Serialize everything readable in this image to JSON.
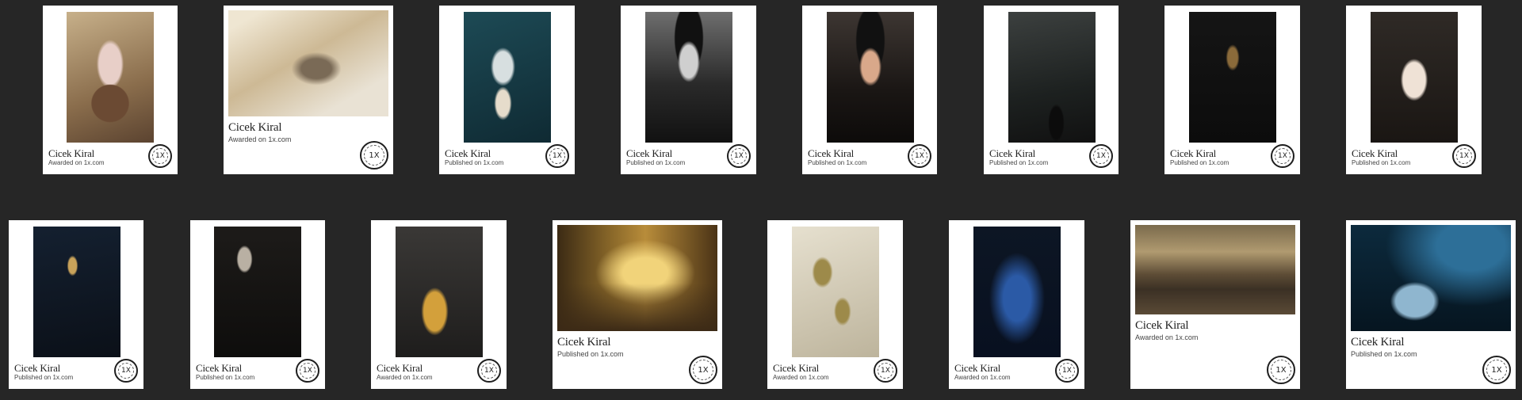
{
  "badge_label": "1X",
  "gallery": {
    "cards": [
      {
        "photographer": "Cicek Kiral",
        "status": "Awarded on 1x.com",
        "subject": "roses in a vase"
      },
      {
        "photographer": "Cicek Kiral",
        "status": "Awarded on 1x.com",
        "subject": "bird in fog"
      },
      {
        "photographer": "Cicek Kiral",
        "status": "Published on 1x.com",
        "subject": "dahlia in white vase"
      },
      {
        "photographer": "Cicek Kiral",
        "status": "Published on 1x.com",
        "subject": "woman in black hat, mono"
      },
      {
        "photographer": "Cicek Kiral",
        "status": "Published on 1x.com",
        "subject": "woman in black hat"
      },
      {
        "photographer": "Cicek Kiral",
        "status": "Published on 1x.com",
        "subject": "branch in black vase"
      },
      {
        "photographer": "Cicek Kiral",
        "status": "Published on 1x.com",
        "subject": "dried flower with smoke"
      },
      {
        "photographer": "Cicek Kiral",
        "status": "Published on 1x.com",
        "subject": "woman in white coat"
      },
      {
        "photographer": "Cicek Kiral",
        "status": "Published on 1x.com",
        "subject": "dried flower stems on blue"
      },
      {
        "photographer": "Cicek Kiral",
        "status": "Published on 1x.com",
        "subject": "dried seed pods"
      },
      {
        "photographer": "Cicek Kiral",
        "status": "Awarded on 1x.com",
        "subject": "dried flowers in golden vase"
      },
      {
        "photographer": "Cicek Kiral",
        "status": "Published on 1x.com",
        "subject": "autumn forest with hammock"
      },
      {
        "photographer": "Cicek Kiral",
        "status": "Awarded on 1x.com",
        "subject": "dried grass heads with butterfly"
      },
      {
        "photographer": "Cicek Kiral",
        "status": "Awarded on 1x.com",
        "subject": "seed heads on blue"
      },
      {
        "photographer": "Cicek Kiral",
        "status": "Awarded on 1x.com",
        "subject": "sheep herd under stormy sky"
      },
      {
        "photographer": "Cicek Kiral",
        "status": "Published on 1x.com",
        "subject": "snail in blue light"
      }
    ]
  }
}
